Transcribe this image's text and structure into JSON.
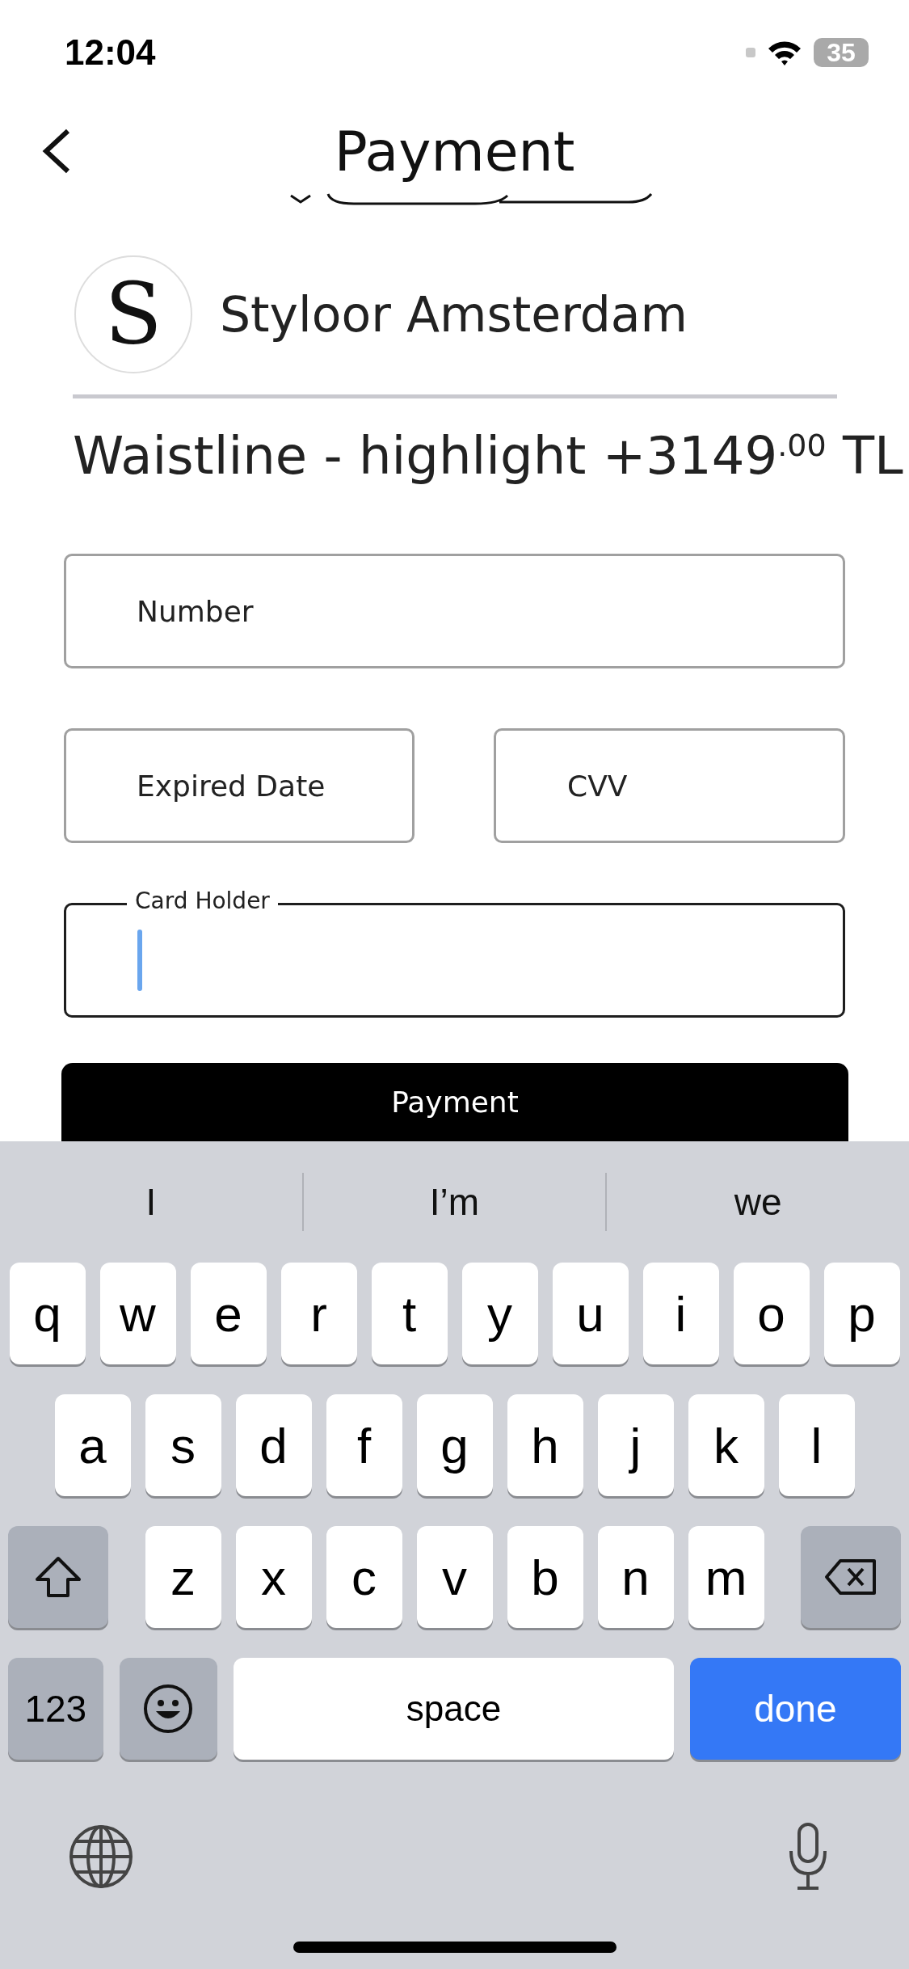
{
  "status_bar": {
    "time": "12:04",
    "battery": "35"
  },
  "nav": {
    "title": "Payment"
  },
  "store": {
    "logo_letter": "S",
    "name": "Styloor Amsterdam"
  },
  "product": {
    "line": "Waistline - highlight +3149$^{.00}$ TL"
  },
  "field_rows": [
    [
      {
        "label": "Number",
        "focused": false
      }
    ],
    [
      {
        "label": "Expired Date",
        "focused": false
      },
      {
        "label": "CVV",
        "focused": false
      }
    ],
    [
      {
        "label": "Card Holder",
        "focused": true
      }
    ]
  ],
  "submit": {
    "label": "Payment"
  },
  "keyboard": {
    "suggestions": [
      "I",
      "I’m",
      "we"
    ],
    "rows": [
      [
        "q",
        "w",
        "e",
        "r",
        "t",
        "y",
        "u",
        "i",
        "o",
        "p"
      ],
      [
        "a",
        "s",
        "d",
        "f",
        "g",
        "h",
        "j",
        "k",
        "l"
      ],
      [
        "z",
        "x",
        "c",
        "v",
        "b",
        "n",
        "m"
      ]
    ],
    "numbers_key": "123",
    "space_key": "space",
    "return_key": "done"
  }
}
